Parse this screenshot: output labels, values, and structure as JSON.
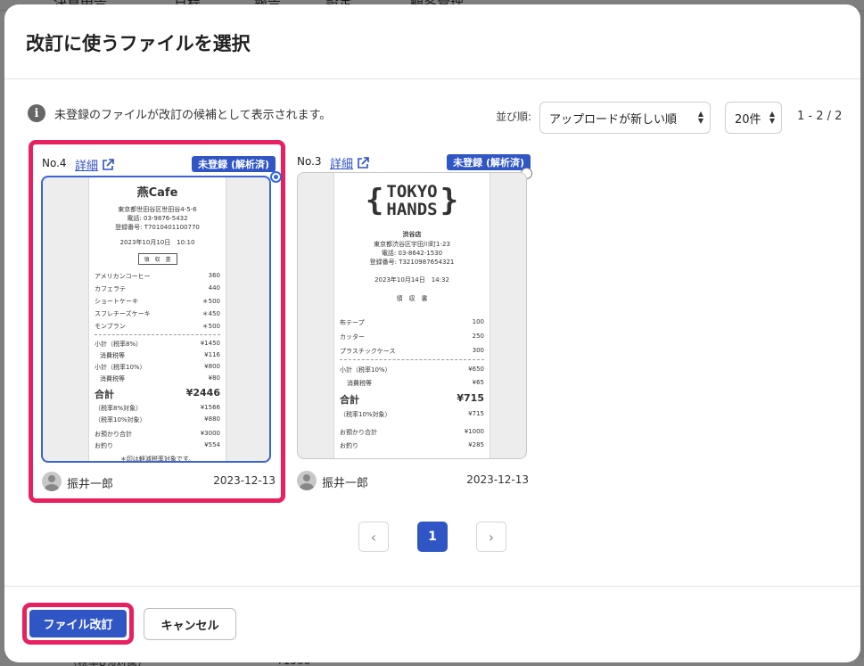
{
  "background": {
    "nav_items": [
      "決算申告",
      "日程",
      "報告",
      "設定",
      "顧客管理"
    ],
    "bottom_text": "（税率8%対象）",
    "bottom_amount": "¥1566"
  },
  "modal": {
    "title": "改訂に使うファイルを選択",
    "info_icon": "i",
    "info_text": "未登録のファイルが改訂の候補として表示されます。",
    "sort_label": "並び順:",
    "sort_value": "アップロードが新しい順",
    "count_value": "20件",
    "range_text": "1 - 2 / 2",
    "pagination": {
      "prev_icon": "‹",
      "current_page": "1",
      "next_icon": "›"
    },
    "primary_button": "ファイル改訂",
    "secondary_button": "キャンセル"
  },
  "cards": [
    {
      "number": "No.4",
      "detail_link": "詳細",
      "status": "未登録 (解析済)",
      "selected": true,
      "owner": "振井一郎",
      "date": "2023-12-13",
      "receipt": {
        "store": "燕Cafe",
        "address": "東京都世田谷区世田谷4-5-6",
        "phone": "電話: 03-9876-5432",
        "reg": "登録番号: T7010401100770",
        "datetime": "2023年10月10日　10:10",
        "doc": "領　収　書",
        "items": [
          {
            "name": "アメリカンコーヒー",
            "price": "360"
          },
          {
            "name": "カフェラテ",
            "price": "440"
          },
          {
            "name": "ショートケーキ",
            "price": "＊500"
          },
          {
            "name": "スフレチーズケーキ",
            "price": "＊450"
          },
          {
            "name": "モンブラン",
            "price": "＊500"
          }
        ],
        "sub1": {
          "name": "小計（税率8%）",
          "price": "¥1450"
        },
        "tax1": {
          "name": "消費税等",
          "price": "¥116"
        },
        "sub2": {
          "name": "小計（税率10%）",
          "price": "¥800"
        },
        "tax2": {
          "name": "消費税等",
          "price": "¥80"
        },
        "total": {
          "name": "合計",
          "price": "¥2446"
        },
        "rate1": {
          "name": "（税率8%対象）",
          "price": "¥1566"
        },
        "rate2": {
          "name": "（税率10%対象）",
          "price": "¥880"
        },
        "paid": {
          "name": "お預かり合計",
          "price": "¥3000"
        },
        "change": {
          "name": "お釣り",
          "price": "¥554"
        },
        "note": "＊印は軽減税率対象です。"
      }
    },
    {
      "number": "No.3",
      "detail_link": "詳細",
      "status": "未登録 (解析済)",
      "selected": false,
      "owner": "振井一郎",
      "date": "2023-12-13",
      "receipt": {
        "logo_line1": "TOKYO",
        "logo_line2": "HANDS",
        "store": "渋谷店",
        "address": "東京都渋谷区宇田川町1-23",
        "phone": "電話: 03-8642-1530",
        "reg": "登録番号: T3210987654321",
        "datetime": "2023年10月14日　14:32",
        "doc": "領　収　書",
        "items": [
          {
            "name": "布テープ",
            "price": "100"
          },
          {
            "name": "カッター",
            "price": "250"
          },
          {
            "name": "プラスチックケース",
            "price": "300"
          }
        ],
        "sub1": {
          "name": "小計（税率10%）",
          "price": "¥650"
        },
        "tax1": {
          "name": "消費税等",
          "price": "¥65"
        },
        "total": {
          "name": "合計",
          "price": "¥715"
        },
        "rate1": {
          "name": "（税率10%対象）",
          "price": "¥715"
        },
        "paid": {
          "name": "お預かり合計",
          "price": "¥1000"
        },
        "change": {
          "name": "お釣り",
          "price": "¥285"
        }
      }
    }
  ]
}
